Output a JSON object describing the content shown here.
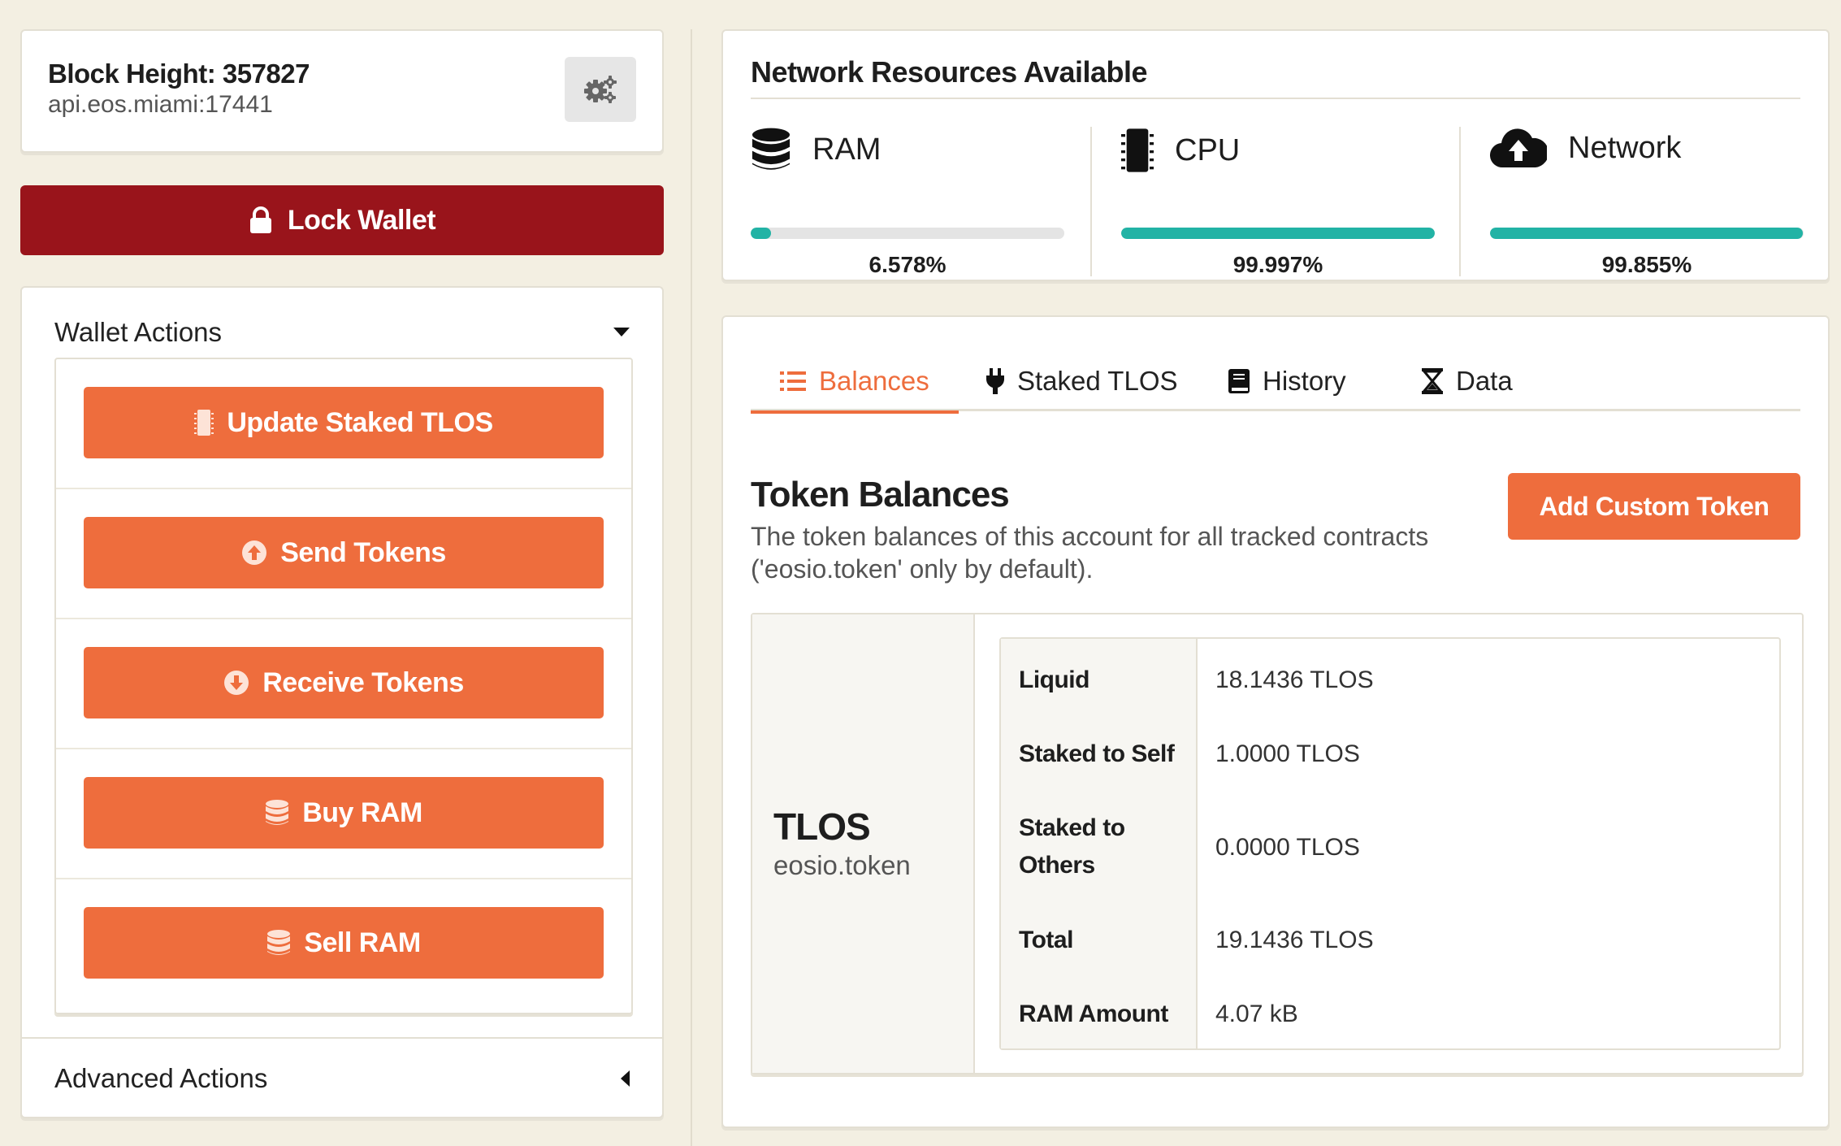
{
  "node": {
    "block_height_label": "Block Height:",
    "block_height_value": "357827",
    "api": "api.eos.miami:17441",
    "settings_icon": "cogs-icon"
  },
  "lock_wallet": {
    "label": "Lock Wallet",
    "icon": "lock-icon",
    "color": "#99141b"
  },
  "wallet_actions": {
    "title": "Wallet Actions",
    "items": [
      {
        "label": "Update Staked TLOS",
        "icon": "microchip-icon"
      },
      {
        "label": "Send Tokens",
        "icon": "arrow-circle-up-icon"
      },
      {
        "label": "Receive Tokens",
        "icon": "arrow-circle-down-icon"
      },
      {
        "label": "Buy RAM",
        "icon": "database-icon"
      },
      {
        "label": "Sell RAM",
        "icon": "database-icon"
      }
    ],
    "button_color": "#ee6d3d"
  },
  "advanced_actions": {
    "title": "Advanced Actions"
  },
  "network": {
    "title": "Network Resources Available",
    "resources": [
      {
        "name": "RAM",
        "icon": "database-icon",
        "percent_label": "6.578%",
        "fraction": 0.06578
      },
      {
        "name": "CPU",
        "icon": "microchip-icon",
        "percent_label": "99.997%",
        "fraction": 0.99997
      },
      {
        "name": "Network",
        "icon": "cloud-upload-icon",
        "percent_label": "99.855%",
        "fraction": 0.99855
      }
    ],
    "bar_color": "#22b3a5"
  },
  "tabs": [
    {
      "label": "Balances",
      "icon": "list-icon",
      "active": true
    },
    {
      "label": "Staked TLOS",
      "icon": "plug-icon",
      "active": false
    },
    {
      "label": "History",
      "icon": "book-icon",
      "active": false
    },
    {
      "label": "Data",
      "icon": "hourglass-icon",
      "active": false
    }
  ],
  "token_balances": {
    "title": "Token Balances",
    "description": "The token balances of this account for all tracked contracts ('eosio.token' only by default).",
    "add_button": "Add Custom Token",
    "token": {
      "symbol": "TLOS",
      "contract": "eosio.token"
    },
    "rows": [
      {
        "label": "Liquid",
        "value": "18.1436 TLOS"
      },
      {
        "label": "Staked to Self",
        "value": "1.0000 TLOS"
      },
      {
        "label": "Staked to Others",
        "value": "0.0000 TLOS"
      },
      {
        "label": "Total",
        "value": "19.1436 TLOS"
      },
      {
        "label": "RAM Amount",
        "value": "4.07 kB"
      }
    ]
  },
  "accent_color": "#ee6d3d"
}
